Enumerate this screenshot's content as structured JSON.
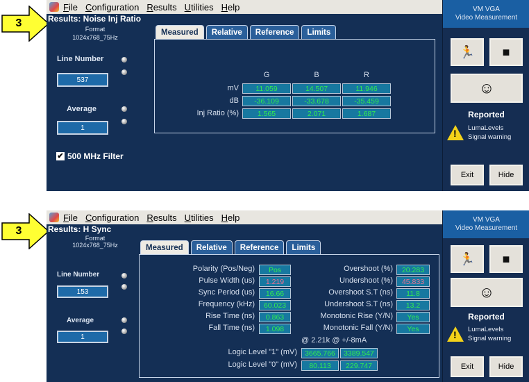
{
  "step_number": "3",
  "menu": [
    "File",
    "Configuration",
    "Results",
    "Utilities",
    "Help"
  ],
  "menu_access": [
    "F",
    "C",
    "R",
    "U",
    "H"
  ],
  "menu_rest": [
    "ile",
    "onfiguration",
    "esults",
    "tilities",
    "elp"
  ],
  "right_panel": {
    "title_line1": "VM VGA",
    "title_line2": "Video Measurement",
    "reported": "Reported",
    "warn_line1": "LumaLevels",
    "warn_line2": "Signal warning",
    "exit": "Exit",
    "hide": "Hide"
  },
  "tabs": [
    "Measured",
    "Relative",
    "Reference",
    "Limits"
  ],
  "panel1": {
    "title": "Results: Noise Inj Ratio",
    "format_label": "Format",
    "format_value": "1024x768_75Hz",
    "line_number_label": "Line Number",
    "line_number": "537",
    "average_label": "Average",
    "average": "1",
    "filter_label": "500 MHz Filter",
    "filter_checked": true,
    "columns": [
      "G",
      "B",
      "R"
    ],
    "rows": [
      {
        "label": "mV",
        "values": [
          "11.059",
          "14.507",
          "11.946"
        ]
      },
      {
        "label": "dB",
        "values": [
          "-36.109",
          "-33.678",
          "-35.459"
        ]
      },
      {
        "label": "Inj Ratio (%)",
        "values": [
          "1.565",
          "2.071",
          "1.687"
        ]
      }
    ]
  },
  "panel2": {
    "title": "Results: H Sync",
    "format_label": "Format",
    "format_value": "1024x768_75Hz",
    "line_number_label": "Line Number",
    "line_number": "153",
    "average_label": "Average",
    "average": "1",
    "left_rows": [
      {
        "label": "Polarity (Pos/Neg)",
        "value": "Pos",
        "status": "pass"
      },
      {
        "label": "Pulse Width (us)",
        "value": "1.219",
        "status": "fail"
      },
      {
        "label": "Sync Period (us)",
        "value": "16.66",
        "status": "pass"
      },
      {
        "label": "Frequency (kHz)",
        "value": "60.023",
        "status": "pass"
      },
      {
        "label": "Rise Time (ns)",
        "value": "0.863",
        "status": "pass"
      },
      {
        "label": "Fall Time (ns)",
        "value": "1.098",
        "status": "pass"
      }
    ],
    "right_rows": [
      {
        "label": "Overshoot (%)",
        "value": "20.283",
        "status": "pass"
      },
      {
        "label": "Undershoot (%)",
        "value": "45.833",
        "status": "fail"
      },
      {
        "label": "Overshoot S.T (ns)",
        "value": "11.8",
        "status": "pass"
      },
      {
        "label": "Undershoot S.T (ns)",
        "value": "13.2",
        "status": "pass"
      },
      {
        "label": "Monotonic Rise (Y/N)",
        "value": "Yes",
        "status": "pass"
      },
      {
        "label": "Monotonic Fall (Y/N)",
        "value": "Yes",
        "status": "pass"
      }
    ],
    "condition": "@ 2.21k @ +/-8mA",
    "logic_rows": [
      {
        "label": "Logic Level \"1\" (mV)",
        "values": [
          "3665.766",
          "3389.547"
        ]
      },
      {
        "label": "Logic Level \"0\" (mV)",
        "values": [
          "80.113",
          "229.747"
        ]
      }
    ]
  },
  "colors": {
    "pass": "#32ec50",
    "fail": "#f07090",
    "app_bg": "#142f55",
    "cell_bg": "#1778a0",
    "arrow": "#ffff33"
  },
  "icons": [
    "app-logo-icon",
    "run-icon",
    "stop-icon",
    "signal-face-icon",
    "warning-icon",
    "checkbox-icon"
  ]
}
